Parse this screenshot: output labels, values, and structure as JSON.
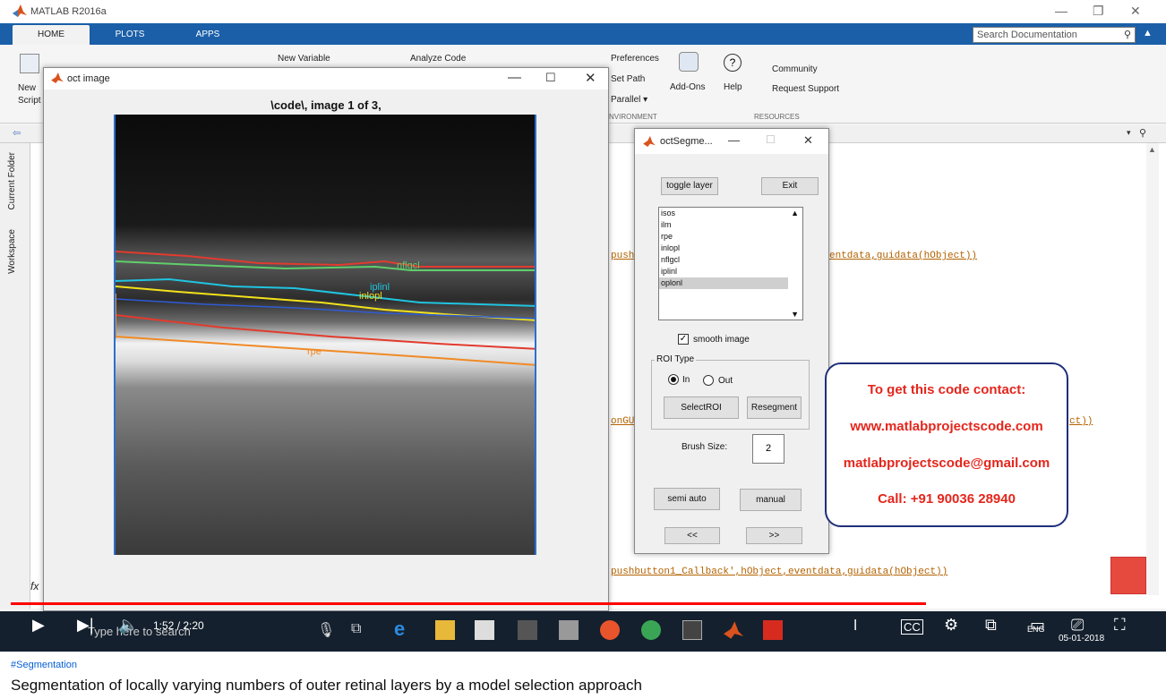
{
  "matlab": {
    "title": "MATLAB R2016a",
    "tabs": [
      {
        "label": "HOME",
        "active": true
      },
      {
        "label": "PLOTS",
        "active": false
      },
      {
        "label": "APPS",
        "active": false
      }
    ],
    "search_placeholder": "Search Documentation",
    "ribbon": {
      "new_script": "New",
      "new_script2": "Script",
      "new_variable": "New Variable",
      "analyze_code": "Analyze Code",
      "preferences": "Preferences",
      "set_path": "Set Path",
      "parallel": "Parallel ▾",
      "environment": "NVIRONMENT",
      "add_ons": "Add-Ons",
      "help": "Help",
      "community": "Community",
      "request_support": "Request Support",
      "resources": "RESOURCES"
    },
    "side_tabs": [
      "Current Folder",
      "Workspace"
    ],
    "fx_label": "fx",
    "code_lines": [
      "push",
      "entdata,guidata(hObject))",
      "onGU",
      "ct))",
      "pushbutton1_Callback',hObject,eventdata,guidata(hObject))"
    ]
  },
  "oct_window": {
    "title": "oct image",
    "image_title": "\\code\\, image 1 of 3,",
    "layer_labels": [
      "nflgcl",
      "iplinl",
      "inlopl",
      "rpe"
    ]
  },
  "seg_window": {
    "title": "octSegme...",
    "toggle_layer": "toggle layer",
    "exit": "Exit",
    "layers": [
      "isos",
      "ilm",
      "rpe",
      "inlopl",
      "nflgcl",
      "iplinl",
      "oplonl"
    ],
    "selected_layer_index": 6,
    "smooth_image": "smooth image",
    "smooth_checked": true,
    "roi_type": "ROI Type",
    "roi_in": "In",
    "roi_out": "Out",
    "roi_selected": "In",
    "select_roi": "SelectROI",
    "resegment": "Resegment",
    "brush_size_label": "Brush Size:",
    "brush_size": "2",
    "semi_auto": "semi auto",
    "manual": "manual",
    "prev": "<<",
    "next": ">>"
  },
  "contact": {
    "line1": "To get this code contact:",
    "line2": "www.matlabprojectscode.com",
    "line3": "matlabprojectscode@gmail.com",
    "line4": "Call: +91 90036 28940"
  },
  "taskbar": {
    "search_placeholder": "Type here to search",
    "date": "05-01-2018",
    "lang": "ENG"
  },
  "player": {
    "time": "1:52 / 2:20",
    "progress": 0.8
  },
  "video_info": {
    "hashtag": "#Segmentation",
    "title": "Segmentation of locally varying numbers of outer retinal layers by a model selection approach"
  },
  "colors": {
    "accent": "#1b5fa8",
    "progress": "#ff0000",
    "contact_text": "#e4261c",
    "contact_border": "#1f2f7a"
  }
}
